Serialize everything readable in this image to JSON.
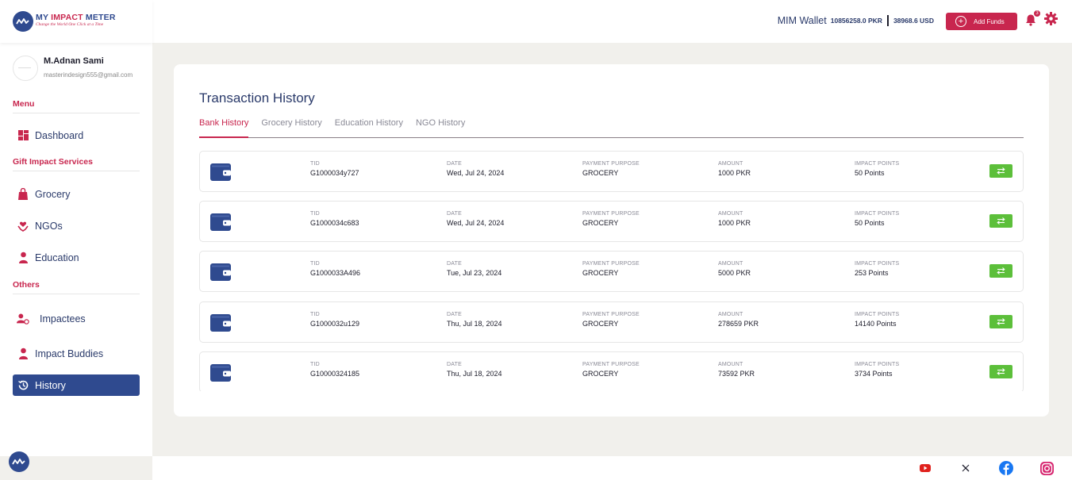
{
  "brand": {
    "title_part1": "MY",
    "title_part2": "IMPACT",
    "title_part3": "METER",
    "tagline": "Change the World One Click at a Time"
  },
  "user": {
    "name": "M.Adnan Sami",
    "email": "masterindesign555@gmail.com"
  },
  "sidebar": {
    "menu_title": "Menu",
    "gift_title": "Gift Impact Services",
    "others_title": "Others",
    "items": [
      {
        "label": "Dashboard",
        "icon": "dashboard-icon"
      },
      {
        "label": "Grocery",
        "icon": "grocery-bag-icon"
      },
      {
        "label": "NGOs",
        "icon": "ngo-hands-icon"
      },
      {
        "label": "Education",
        "icon": "graduate-icon"
      },
      {
        "label": "Impactees",
        "icon": "impactees-icon"
      },
      {
        "label": "Impact Buddies",
        "icon": "buddy-icon"
      },
      {
        "label": "History",
        "icon": "history-icon",
        "active": true
      }
    ]
  },
  "header": {
    "wallet_label": "MIM Wallet",
    "wallet_pkr": "10856258.0 PKR",
    "wallet_usd": "38968.6 USD",
    "add_funds_label": "Add Funds",
    "notification_count": "3"
  },
  "main": {
    "title": "Transaction History",
    "tabs": [
      "Bank History",
      "Grocery History",
      "Education History",
      "NGO History"
    ],
    "active_tab": 0,
    "column_labels": {
      "tid": "TID",
      "date": "DATE",
      "purpose": "PAYMENT PURPOSE",
      "amount": "AMOUNT",
      "points": "IMPACT POINTS"
    },
    "transactions": [
      {
        "tid": "G1000034y727",
        "date": "Wed, Jul 24, 2024",
        "purpose": "GROCERY",
        "amount": "1000 PKR",
        "points": "50 Points"
      },
      {
        "tid": "G1000034c683",
        "date": "Wed, Jul 24, 2024",
        "purpose": "GROCERY",
        "amount": "1000 PKR",
        "points": "50 Points"
      },
      {
        "tid": "G1000033A496",
        "date": "Tue, Jul 23, 2024",
        "purpose": "GROCERY",
        "amount": "5000 PKR",
        "points": "253 Points"
      },
      {
        "tid": "G1000032u129",
        "date": "Thu, Jul 18, 2024",
        "purpose": "GROCERY",
        "amount": "278659 PKR",
        "points": "14140 Points"
      },
      {
        "tid": "G10000324185",
        "date": "Thu, Jul 18, 2024",
        "purpose": "GROCERY",
        "amount": "73592 PKR",
        "points": "3734 Points"
      }
    ]
  },
  "footer": {
    "social_icons": [
      "youtube-icon",
      "x-icon",
      "facebook-icon",
      "instagram-icon"
    ]
  },
  "colors": {
    "brand_blue": "#2f4a8f",
    "brand_red": "#c8264e",
    "action_green": "#5cbf3a"
  }
}
